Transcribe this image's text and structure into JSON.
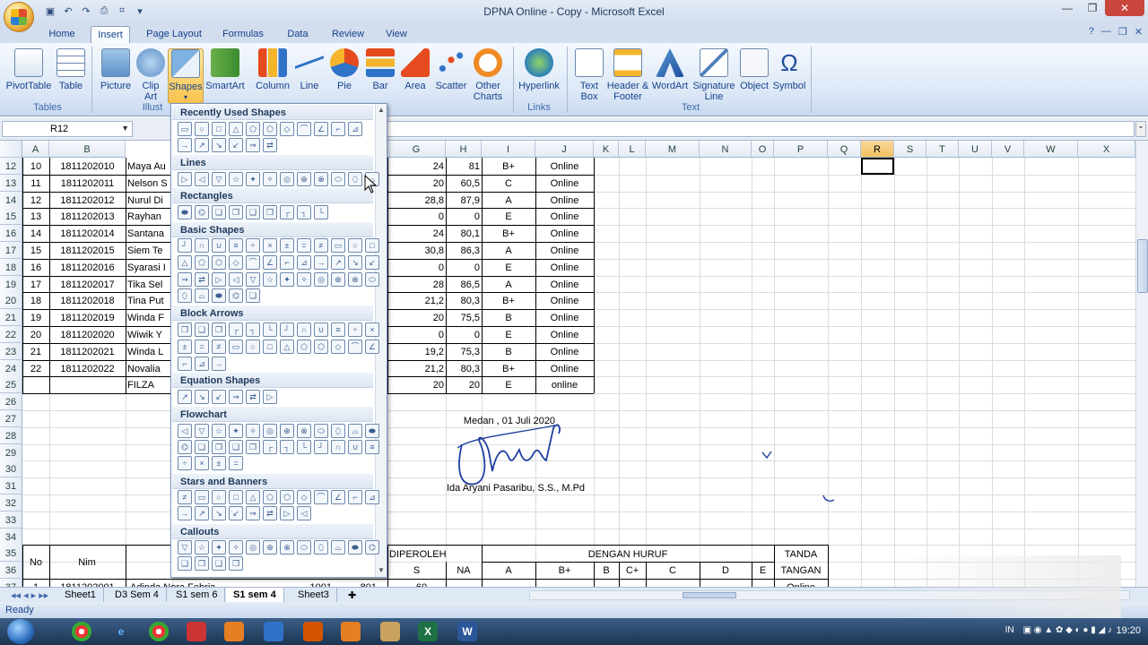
{
  "window": {
    "title": "DPNA Online - Copy - Microsoft Excel"
  },
  "tabs": [
    "Home",
    "Insert",
    "Page Layout",
    "Formulas",
    "Data",
    "Review",
    "View"
  ],
  "ribbon": {
    "buttons": [
      {
        "label": "PivotTable",
        "icon": "pivottable-icon"
      },
      {
        "label": "Table",
        "icon": "table-icon"
      },
      {
        "label": "Picture",
        "icon": "picture-icon"
      },
      {
        "label": "Clip Art",
        "icon": "clip-art-icon"
      },
      {
        "label": "Shapes",
        "icon": "shapes-icon"
      },
      {
        "label": "SmartArt",
        "icon": "smartart-icon"
      },
      {
        "label": "Column",
        "icon": "column-chart-icon"
      },
      {
        "label": "Line",
        "icon": "line-chart-icon"
      },
      {
        "label": "Pie",
        "icon": "pie-chart-icon"
      },
      {
        "label": "Bar",
        "icon": "bar-chart-icon"
      },
      {
        "label": "Area",
        "icon": "area-chart-icon"
      },
      {
        "label": "Scatter",
        "icon": "scatter-chart-icon"
      },
      {
        "label": "Other Charts",
        "icon": "other-charts-icon"
      },
      {
        "label": "Hyperlink",
        "icon": "hyperlink-icon"
      },
      {
        "label": "Text Box",
        "icon": "text-box-icon"
      },
      {
        "label": "Header & Footer",
        "icon": "header-footer-icon"
      },
      {
        "label": "WordArt",
        "icon": "wordart-icon"
      },
      {
        "label": "Signature Line",
        "icon": "signature-line-icon"
      },
      {
        "label": "Object",
        "icon": "object-icon"
      },
      {
        "label": "Symbol",
        "icon": "symbol-icon"
      }
    ],
    "groups": {
      "tables": "Tables",
      "illustrations": "Illust",
      "links": "Links",
      "text": "Text"
    }
  },
  "formula_bar": {
    "name_box": "R12",
    "fx_value": ""
  },
  "columns": [
    "A",
    "B",
    "G",
    "H",
    "I",
    "J",
    "K",
    "L",
    "M",
    "N",
    "O",
    "P",
    "Q",
    "R",
    "S",
    "T",
    "U",
    "V",
    "W",
    "X"
  ],
  "selected_column": "R",
  "row_numbers": [
    "12",
    "13",
    "14",
    "15",
    "16",
    "17",
    "18",
    "19",
    "20",
    "21",
    "22",
    "23",
    "24",
    "25",
    "26",
    "27",
    "28",
    "29",
    "30",
    "31",
    "32",
    "33",
    "34",
    "35",
    "36",
    "37"
  ],
  "data_rows": [
    {
      "a": "10",
      "b": "1811202010",
      "c": "Maya Au",
      "g": "24",
      "h": "81",
      "i": "B+",
      "j": "Online"
    },
    {
      "a": "11",
      "b": "1811202011",
      "c": "Nelson S",
      "g": "20",
      "h": "60,5",
      "i": "C",
      "j": "Online"
    },
    {
      "a": "12",
      "b": "1811202012",
      "c": "Nurul Di",
      "g": "28,8",
      "h": "87,9",
      "i": "A",
      "j": "Online"
    },
    {
      "a": "13",
      "b": "1811202013",
      "c": "Rayhan",
      "g": "0",
      "h": "0",
      "i": "E",
      "j": "Online"
    },
    {
      "a": "14",
      "b": "1811202014",
      "c": "Santana",
      "g": "24",
      "h": "80,1",
      "i": "B+",
      "j": "Online"
    },
    {
      "a": "15",
      "b": "1811202015",
      "c": "Siem Te",
      "g": "30,8",
      "h": "86,3",
      "i": "A",
      "j": "Online"
    },
    {
      "a": "16",
      "b": "1811202016",
      "c": "Syarasi I",
      "g": "0",
      "h": "0",
      "i": "E",
      "j": "Online"
    },
    {
      "a": "17",
      "b": "1811202017",
      "c": "Tika Sel",
      "g": "28",
      "h": "86,5",
      "i": "A",
      "j": "Online"
    },
    {
      "a": "18",
      "b": "1811202018",
      "c": "Tina Put",
      "g": "21,2",
      "h": "80,3",
      "i": "B+",
      "j": "Online"
    },
    {
      "a": "19",
      "b": "1811202019",
      "c": "Winda F",
      "g": "20",
      "h": "75,5",
      "i": "B",
      "j": "Online"
    },
    {
      "a": "20",
      "b": "1811202020",
      "c": "Wiwik Y",
      "g": "0",
      "h": "0",
      "i": "E",
      "j": "Online"
    },
    {
      "a": "21",
      "b": "1811202021",
      "c": "Winda L",
      "g": "19,2",
      "h": "75,3",
      "i": "B",
      "j": "Online"
    },
    {
      "a": "22",
      "b": "1811202022",
      "c": "Novalia",
      "g": "21,2",
      "h": "80,3",
      "i": "B+",
      "j": "Online"
    },
    {
      "a": "",
      "b": "",
      "c": "FILZA",
      "g": "20",
      "h": "20",
      "i": "E",
      "j": "online"
    }
  ],
  "signature_block": {
    "date": "Medan , 01 Juli 2020",
    "signer": "Ida Aryani Pasaribu, S.S., M.Pd"
  },
  "lower_table": {
    "no": "No",
    "nim": "Nim",
    "diperoleh": "DIPEROLEH",
    "dengan_huruf": "DENGAN HURUF",
    "tanda": "TANDA",
    "tangan": "TANGAN",
    "sub": [
      "S",
      "NA",
      "A",
      "B+",
      "B",
      "C+",
      "C",
      "D",
      "E"
    ],
    "partial_row": {
      "a": "1",
      "b": "1811202001",
      "c": "Adinda Nora Febria",
      "g": "1001",
      "h": "801",
      "g2": "60",
      "tanda": "Online"
    }
  },
  "gallery": {
    "sections": [
      "Recently Used Shapes",
      "Lines",
      "Rectangles",
      "Basic Shapes",
      "Block Arrows",
      "Equation Shapes",
      "Flowchart",
      "Stars and Banners",
      "Callouts"
    ]
  },
  "sheets": [
    "Sheet1",
    "D3 Sem 4",
    "S1 sem 6",
    "S1 sem 4",
    "Sheet3"
  ],
  "active_sheet": "S1 sem 4",
  "status": {
    "ready": "Ready"
  },
  "taskbar": {
    "lang": "IN",
    "time": "19:20"
  }
}
